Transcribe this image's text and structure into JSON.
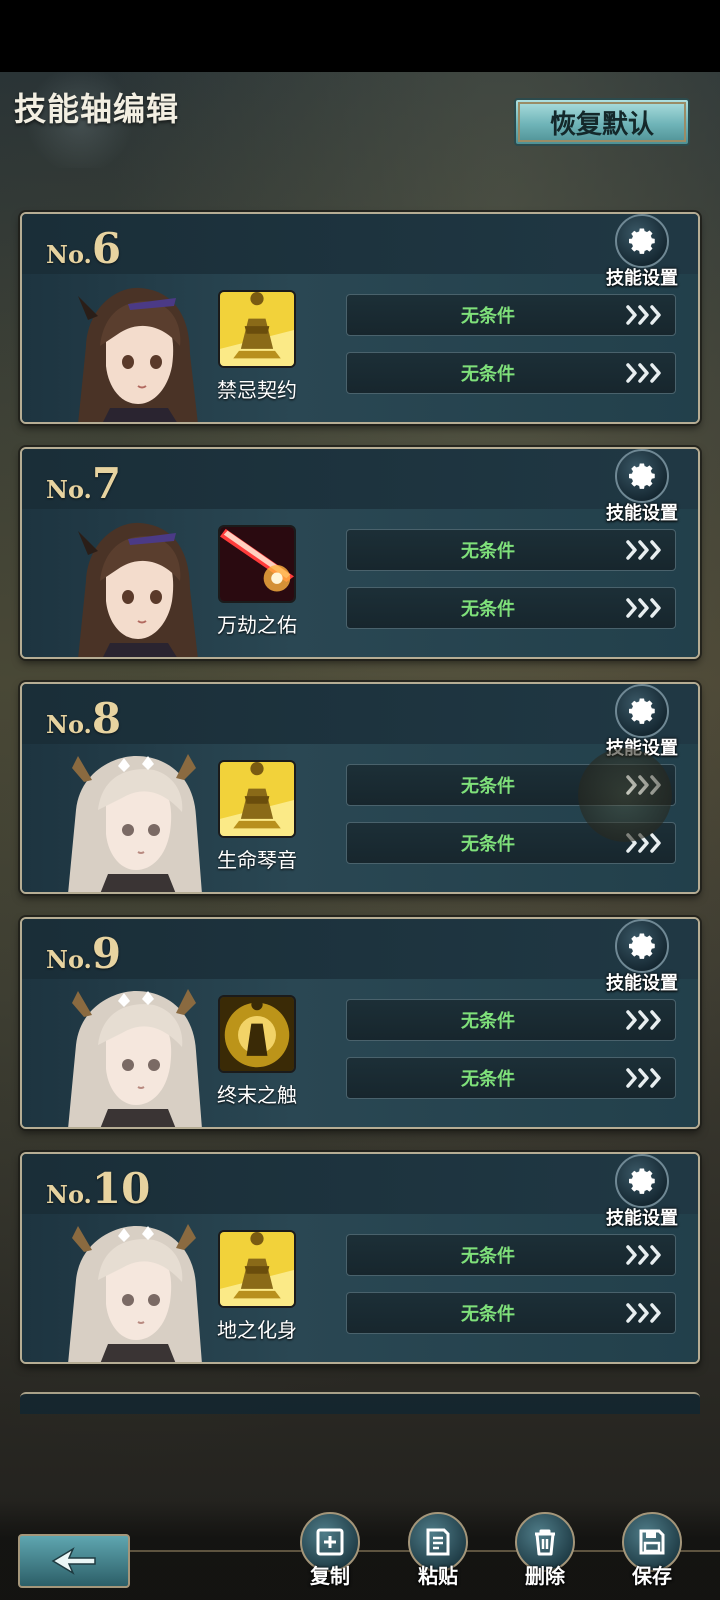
{
  "header": {
    "title": "技能轴编辑",
    "restore_label": "恢复默认"
  },
  "cards": [
    {
      "no_prefix": "No.",
      "no_num": "6",
      "settings_label": "技能设置",
      "skill_name": "禁忌契约",
      "skill_icon": "golden-warrior-icon",
      "conditions": [
        "无条件",
        "无条件"
      ],
      "portrait": "brunette-girl-portrait"
    },
    {
      "no_prefix": "No.",
      "no_num": "7",
      "settings_label": "技能设置",
      "skill_name": "万劫之佑",
      "skill_icon": "red-slash-icon",
      "conditions": [
        "无条件",
        "无条件"
      ],
      "portrait": "brunette-girl-portrait"
    },
    {
      "no_prefix": "No.",
      "no_num": "8",
      "settings_label": "技能设置",
      "skill_name": "生命琴音",
      "skill_icon": "golden-warrior-icon",
      "conditions": [
        "无条件",
        "无条件"
      ],
      "portrait": "silver-hair-antler-girl-portrait"
    },
    {
      "no_prefix": "No.",
      "no_num": "9",
      "settings_label": "技能设置",
      "skill_name": "终末之触",
      "skill_icon": "golden-aura-warrior-icon",
      "conditions": [
        "无条件",
        "无条件"
      ],
      "portrait": "silver-hair-antler-girl-portrait"
    },
    {
      "no_prefix": "No.",
      "no_num": "10",
      "settings_label": "技能设置",
      "skill_name": "地之化身",
      "skill_icon": "golden-warrior-icon",
      "conditions": [
        "无条件",
        "无条件"
      ],
      "portrait": "silver-hair-antler-girl-portrait"
    }
  ],
  "toolbar": {
    "back_icon": "back-arrow-icon",
    "copy_label": "复制",
    "paste_label": "粘贴",
    "delete_label": "删除",
    "save_label": "保存"
  },
  "colors": {
    "condition_text": "#7fe07a",
    "number_gold": "#e7d3a0",
    "card_border": "#b6ad94",
    "restore_button": "#6fb4b8"
  }
}
